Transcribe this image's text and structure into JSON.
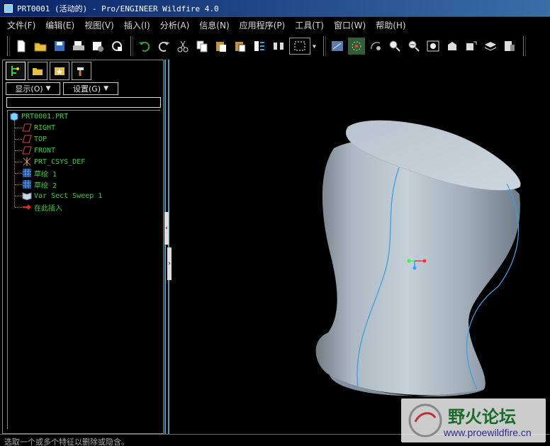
{
  "window": {
    "title": "PRT0001 (活动的) - Pro/ENGINEER Wildfire 4.0"
  },
  "menu": [
    "文件(F)",
    "编辑(E)",
    "视图(V)",
    "插入(I)",
    "分析(A)",
    "信息(N)",
    "应用程序(P)",
    "工具(T)",
    "窗口(W)",
    "帮助(H)"
  ],
  "toolbar": {
    "icons": [
      "new-icon",
      "open-icon",
      "save-icon",
      "print-icon",
      "send-icon",
      "erase-icon",
      "undo-icon",
      "redo-icon",
      "cut-icon",
      "copy-icon",
      "paste-icon",
      "paste-special-icon",
      "regenerate-icon",
      "find-icon",
      "select-box-icon",
      "repaint-icon",
      "spin-center-icon",
      "orient-icon",
      "zoom-in-icon",
      "zoom-out-icon",
      "refit-icon",
      "reorient-icon",
      "saved-views-icon",
      "layers-icon",
      "view-manager-icon"
    ]
  },
  "leftpanel": {
    "show_label": "显示(O)",
    "settings_label": "设置(G)",
    "filter_value": "",
    "tree": [
      {
        "label": "PRT0001.PRT",
        "icon": "part-icon"
      },
      {
        "label": "RIGHT",
        "icon": "datum-plane-icon"
      },
      {
        "label": "TOP",
        "icon": "datum-plane-icon"
      },
      {
        "label": "FRONT",
        "icon": "datum-plane-icon"
      },
      {
        "label": "PRT_CSYS_DEF",
        "icon": "csys-icon"
      },
      {
        "label": "草绘 1",
        "icon": "sketch-icon"
      },
      {
        "label": "草绘 2",
        "icon": "sketch-icon"
      },
      {
        "label": "Var Sect Sweep 1",
        "icon": "sweep-icon"
      },
      {
        "label": "在此插入",
        "icon": "insert-here-icon"
      }
    ]
  },
  "status": {
    "message": "选取一个或多个特征以删除或隐含。"
  },
  "watermark": {
    "text": "野火论坛",
    "url": "www.proewildfire.cn"
  },
  "colors": {
    "tree_text": "#3ccc3c",
    "model": "#a9b6c0",
    "edge": "#3aa0e0"
  }
}
